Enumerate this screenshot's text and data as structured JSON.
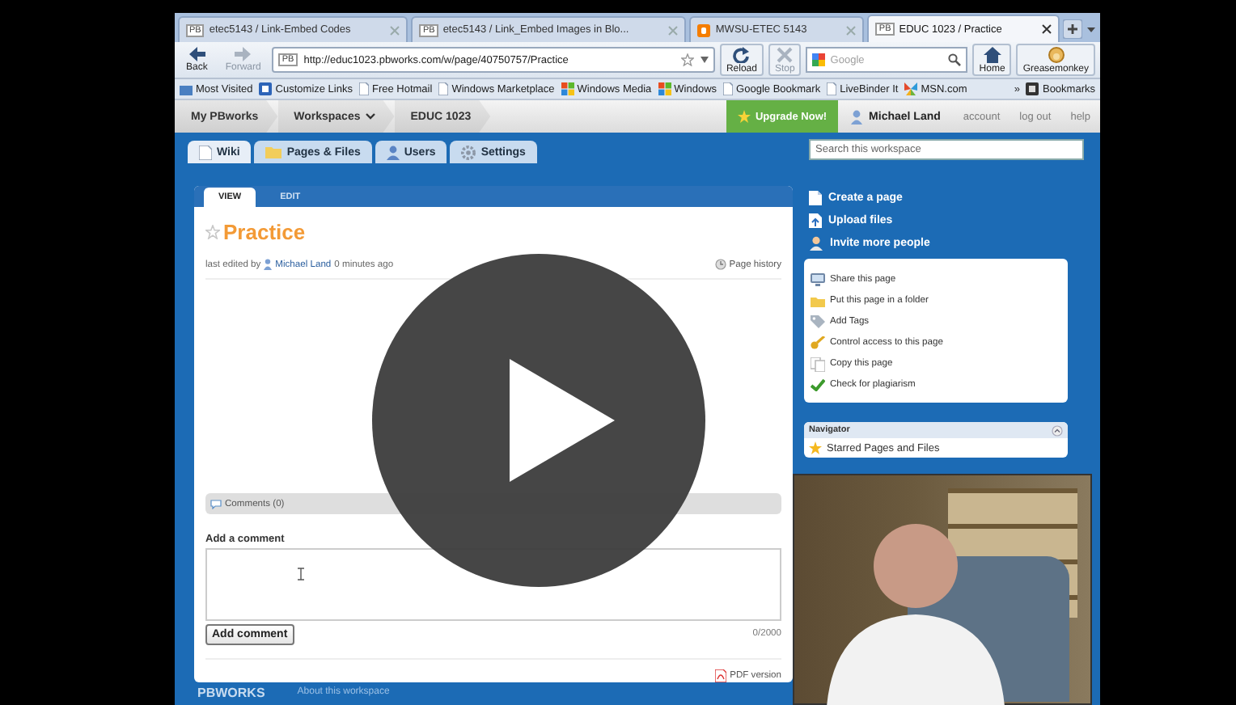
{
  "browser": {
    "tabs": [
      {
        "kind": "pb",
        "badge": "PB",
        "label": "etec5143 / Link-Embed Codes",
        "selected": false
      },
      {
        "kind": "pb",
        "badge": "PB",
        "label": "etec5143 / Link_Embed Images in Blo...",
        "selected": false
      },
      {
        "kind": "blogger",
        "label": "MWSU-ETEC 5143",
        "selected": false
      },
      {
        "kind": "pb",
        "badge": "PB",
        "label": "EDUC 1023 / Practice",
        "selected": true
      }
    ],
    "nav_buttons": [
      {
        "kind": "back",
        "label": "Back",
        "disabled": false
      },
      {
        "kind": "forward",
        "label": "Forward",
        "disabled": true
      }
    ],
    "address": {
      "badge": "PB",
      "value": "http://educ1023.pbworks.com/w/page/40750757/Practice"
    },
    "page_buttons": [
      {
        "kind": "reload",
        "label": "Reload",
        "disabled": false
      },
      {
        "kind": "stop",
        "label": "Stop",
        "disabled": true
      }
    ],
    "search": {
      "placeholder": "Google"
    },
    "end_buttons": [
      {
        "kind": "home",
        "label": "Home",
        "disabled": false
      },
      {
        "kind": "greasemonkey",
        "label": "Greasemonkey",
        "disabled": false
      }
    ],
    "bookmarks": {
      "items": [
        {
          "kind": "star-folder",
          "label": "Most Visited"
        },
        {
          "kind": "customize",
          "label": "Customize Links"
        },
        {
          "kind": "page",
          "label": "Free Hotmail"
        },
        {
          "kind": "page",
          "label": "Windows Marketplace"
        },
        {
          "kind": "windows",
          "label": "Windows Media"
        },
        {
          "kind": "windows",
          "label": "Windows"
        },
        {
          "kind": "page",
          "label": "Google Bookmark"
        },
        {
          "kind": "page",
          "label": "LiveBinder It"
        },
        {
          "kind": "msn",
          "label": "MSN.com"
        }
      ],
      "overflow": "»",
      "folder": "Bookmarks"
    }
  },
  "pbworks": {
    "breadcrumbs": [
      {
        "label": "My PBworks",
        "dropdown": false
      },
      {
        "label": "Workspaces",
        "dropdown": true
      },
      {
        "label": "EDUC 1023",
        "dropdown": false
      }
    ],
    "upgrade": "Upgrade Now!",
    "user": "Michael Land",
    "links": [
      "account",
      "log out",
      "help"
    ],
    "tabs": [
      {
        "kind": "wiki",
        "label": "Wiki",
        "selected": true
      },
      {
        "kind": "pages",
        "label": "Pages & Files",
        "selected": false
      },
      {
        "kind": "users",
        "label": "Users",
        "selected": false
      },
      {
        "kind": "settings",
        "label": "Settings",
        "selected": false
      }
    ],
    "search": {
      "placeholder": "Search this workspace"
    }
  },
  "page": {
    "view_tabs": [
      {
        "label": "VIEW",
        "selected": true
      },
      {
        "label": "EDIT",
        "selected": false
      }
    ],
    "starred": false,
    "title": "Practice",
    "edited": {
      "prefix": "last edited by",
      "author": "Michael Land",
      "suffix": "0 minutes ago"
    },
    "history": "Page history",
    "comments": "Comments (0)",
    "add_comment": {
      "label": "Add a comment",
      "counter": "0/2000",
      "button": "Add comment"
    },
    "pdf": "PDF version"
  },
  "sidebar": {
    "actions": [
      {
        "kind": "create",
        "label": "Create a page"
      },
      {
        "kind": "upload",
        "label": "Upload files"
      },
      {
        "kind": "invite",
        "label": "Invite more people"
      }
    ],
    "tools": [
      {
        "kind": "share",
        "label": "Share this page"
      },
      {
        "kind": "folder",
        "label": "Put this page in a folder"
      },
      {
        "kind": "tags",
        "label": "Add Tags"
      },
      {
        "kind": "key",
        "label": "Control access to this page"
      },
      {
        "kind": "copy",
        "label": "Copy this page"
      },
      {
        "kind": "check",
        "label": "Check for plagiarism"
      }
    ],
    "navigator": {
      "title": "Navigator",
      "items": [
        "Starred Pages and Files"
      ]
    }
  },
  "footer": {
    "logo": "PBWORKS",
    "links": [
      "About this workspace"
    ]
  }
}
